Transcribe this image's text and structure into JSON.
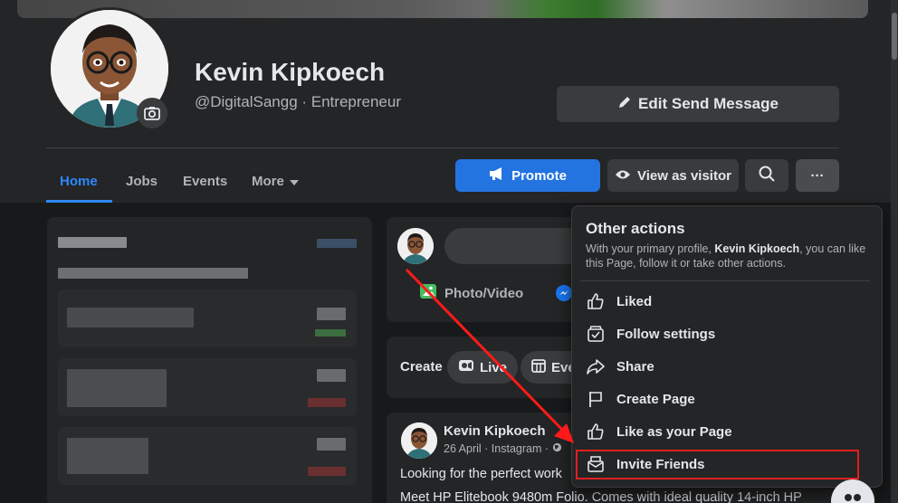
{
  "profile": {
    "name": "Kevin Kipkoech",
    "handle": "@DigitalSangg · Entrepreneur"
  },
  "header": {
    "edit_label": "Edit Send Message",
    "promote_label": "Promote",
    "visitor_label": "View as visitor",
    "more_label": "···"
  },
  "tabs": [
    {
      "label": "Home"
    },
    {
      "label": "Jobs"
    },
    {
      "label": "Events"
    },
    {
      "label": "More"
    }
  ],
  "composer": {
    "photo_label": "Photo/Video"
  },
  "create": {
    "title": "Create",
    "live_label": "Live",
    "event_label": "Eve"
  },
  "post": {
    "author": "Kevin Kipkoech",
    "meta": "26 April · Instagram ·",
    "text1": "Looking for the perfect work",
    "text2": "Meet HP Elitebook 9480m Folio. Comes with ideal quality 14-inch HP"
  },
  "menu": {
    "title": "Other actions",
    "desc_prefix": "With your primary profile, ",
    "desc_name": "Kevin Kipkoech",
    "desc_suffix": ", you can like this Page, follow it or take other actions.",
    "items": [
      {
        "label": "Liked",
        "icon": "thumbs-up-icon"
      },
      {
        "label": "Follow settings",
        "icon": "follow-settings-icon"
      },
      {
        "label": "Share",
        "icon": "share-icon"
      },
      {
        "label": "Create Page",
        "icon": "flag-icon"
      },
      {
        "label": "Like as your Page",
        "icon": "thumbs-up-icon"
      },
      {
        "label": "Invite Friends",
        "icon": "invite-envelope-icon"
      }
    ]
  },
  "colors": {
    "accent": "#2374e1",
    "highlight": "#e02020"
  }
}
